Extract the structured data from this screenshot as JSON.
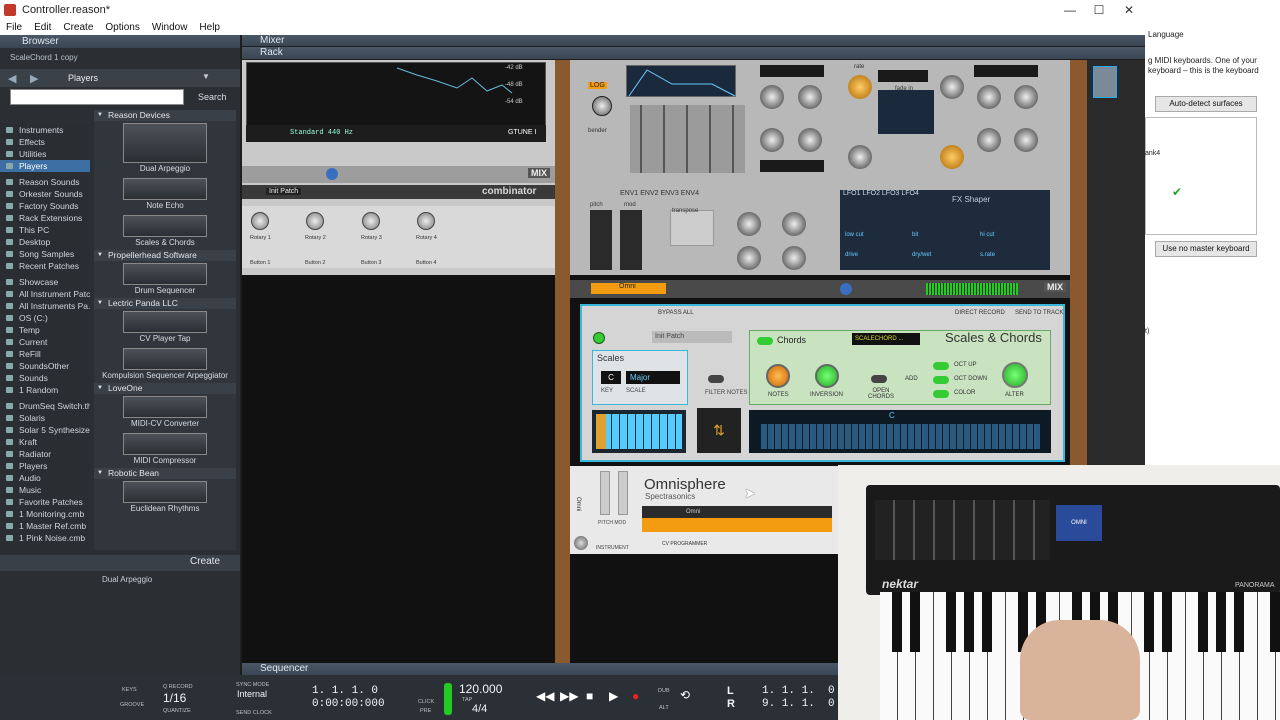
{
  "window": {
    "title": "Controller.reason*",
    "minimize": "—",
    "maximize": "☐",
    "close": "✕"
  },
  "menu": [
    "File",
    "Edit",
    "Create",
    "Options",
    "Window",
    "Help"
  ],
  "browser": {
    "header": "Browser",
    "subtitle": "ScaleChord 1 copy",
    "location": "Players",
    "search_button": "Search",
    "create_button": "Create",
    "selected_device": "Dual Arpeggio",
    "left_items": [
      {
        "label": "Instruments"
      },
      {
        "label": "Effects"
      },
      {
        "label": "Utilities"
      },
      {
        "label": "Players",
        "selected": true
      },
      {
        "label": "Reason Sounds",
        "gap": true
      },
      {
        "label": "Orkester Sounds"
      },
      {
        "label": "Factory Sounds"
      },
      {
        "label": "Rack Extensions"
      },
      {
        "label": "This PC"
      },
      {
        "label": "Desktop"
      },
      {
        "label": "Song Samples"
      },
      {
        "label": "Recent Patches"
      },
      {
        "label": "Showcase",
        "gap": true
      },
      {
        "label": "All Instrument Patc"
      },
      {
        "label": "All Instruments Pa..."
      },
      {
        "label": "OS (C:)"
      },
      {
        "label": "Temp"
      },
      {
        "label": "Current"
      },
      {
        "label": "ReFill"
      },
      {
        "label": "SoundsOther"
      },
      {
        "label": "Sounds"
      },
      {
        "label": "1 Random"
      },
      {
        "label": "DrumSeq Switch.th",
        "gap": true
      },
      {
        "label": "Solaris"
      },
      {
        "label": "Solar 5 Synthesizer"
      },
      {
        "label": "Kraft"
      },
      {
        "label": "Radiator"
      },
      {
        "label": "Players"
      },
      {
        "label": "Audio"
      },
      {
        "label": "Music"
      },
      {
        "label": "Favorite Patches"
      },
      {
        "label": "1 Monitoring.cmb"
      },
      {
        "label": "1 Master Ref.cmb"
      },
      {
        "label": "1 Pink Noise.cmb"
      }
    ],
    "groups": [
      {
        "name": "Reason Devices",
        "devices": [
          "Dual Arpeggio",
          "Note Echo",
          "Scales & Chords"
        ]
      },
      {
        "name": "Propellerhead Software",
        "devices": [
          "Drum Sequencer"
        ]
      },
      {
        "name": "Lectric Panda LLC",
        "devices": [
          "CV Player Tap",
          "Kompulsion Sequencer Arpeggiator"
        ]
      },
      {
        "name": "LoveOne",
        "devices": [
          "MIDI-CV Converter",
          "MIDI Compressor"
        ]
      },
      {
        "name": "Robotic Bean",
        "devices": [
          "Euclidean Rhythms"
        ]
      }
    ]
  },
  "panels": {
    "mixer": "Mixer",
    "rack": "Rack",
    "sequencer": "Sequencer"
  },
  "rack": {
    "tuner_text": "Standard 440 Hz",
    "tuner_brand": "GTUNE I",
    "scope_labels": [
      "-42 dB",
      "-48 dB",
      "-54 dB"
    ],
    "mix_tag": "MIX",
    "combinator_patch": "Init Patch",
    "combinator_logo": "combinator",
    "rotaries": [
      "Rotary 1",
      "Rotary 2",
      "Rotary 3",
      "Rotary 4"
    ],
    "buttons": [
      "Button 1",
      "Button 2",
      "Button 3",
      "Button 4"
    ],
    "synth": {
      "env_tabs": "ENV1  ENV2  ENV3  ENV4",
      "lfo_tabs": "LFO1  LFO2  LFO3  LFO4",
      "fx_title": "FX Shaper",
      "transpose": "transpose",
      "labels": [
        "LOG",
        "bender",
        "up",
        "down",
        "pitch",
        "mod",
        "mod1",
        "mod2",
        "mod3",
        "mod4",
        "rate",
        "time",
        "sync",
        "fade in",
        "form",
        "phase",
        "amt",
        "vel",
        "MONO",
        "SYNC"
      ],
      "fx_labels": [
        "mode",
        "low cut",
        "bit",
        "hi cut",
        "drive",
        "dry/wet",
        "s.rate"
      ]
    },
    "omni_strip_name": "Omni",
    "scales_chords": {
      "bypass": "BYPASS ALL",
      "direct_record": "DIRECT RECORD",
      "send_to_track": "SEND TO TRACK",
      "patch": "Init Patch",
      "scales_title": "Scales",
      "key": "C",
      "scale": "Major",
      "key_label": "KEY",
      "scale_label": "SCALE",
      "filter_notes": "FILTER NOTES",
      "chords_title": "Chords",
      "chord_name": "SCALECHORD ...",
      "brand": "Scales & Chords",
      "notes_label": "NOTES",
      "inversion_label": "INVERSION",
      "open_chords": "OPEN CHORDS",
      "add": "ADD",
      "oct_up": "OCT UP",
      "oct_down": "OCT DOWN",
      "color": "COLOR",
      "alter": "ALTER",
      "key_marker": "C"
    },
    "omnisphere": {
      "title": "Omnisphere",
      "subtitle": "Spectrasonics",
      "patch": "Omni",
      "cv": "CV PROGRAMMER",
      "pitch_mod": "PITCH  MOD",
      "instrument": "INSTRUMENT",
      "side": "Omni"
    }
  },
  "settings": {
    "language": "Language",
    "midi_text": "g MIDI keyboards. One of your keyboard – this is the keyboard",
    "autodetect": "Auto-detect surfaces",
    "list_item": "ank4",
    "check": "✔",
    "no_master": "Use no master keyboard",
    "t_fragment": "t)"
  },
  "keyboard": {
    "brand": "nektar",
    "model": "PANORAMA",
    "screen": "OMNI"
  },
  "transport": {
    "keys_label": "KEYS",
    "groove_label": "GROOVE",
    "quantize_label": "Q RECORD",
    "quantize_value": "1/16",
    "quantize_sub": "QUANTIZE",
    "sync_label": "SYNC MODE",
    "sync_value": "Internal",
    "send_clock": "SEND CLOCK",
    "position_bars": "1. 1. 1.    0",
    "position_time": "0:00:00:000",
    "click_label": "CLICK",
    "pre_label": "PRE",
    "tempo": "120.000",
    "tap": "TAP",
    "signature": "4/4",
    "dub": "DUB",
    "alt": "ALT",
    "left_label": "L",
    "right_label": "R",
    "left_loc": "1. 1. 1.",
    "right_loc": "9. 1. 1.",
    "loc_tail_l": "0",
    "loc_tail_r": "0"
  },
  "colors": {
    "accent": "#3ab6d8",
    "rack_wood": "#8a5a2e",
    "omni_orange": "#f39c12",
    "browser_select": "#3d6fa5"
  }
}
